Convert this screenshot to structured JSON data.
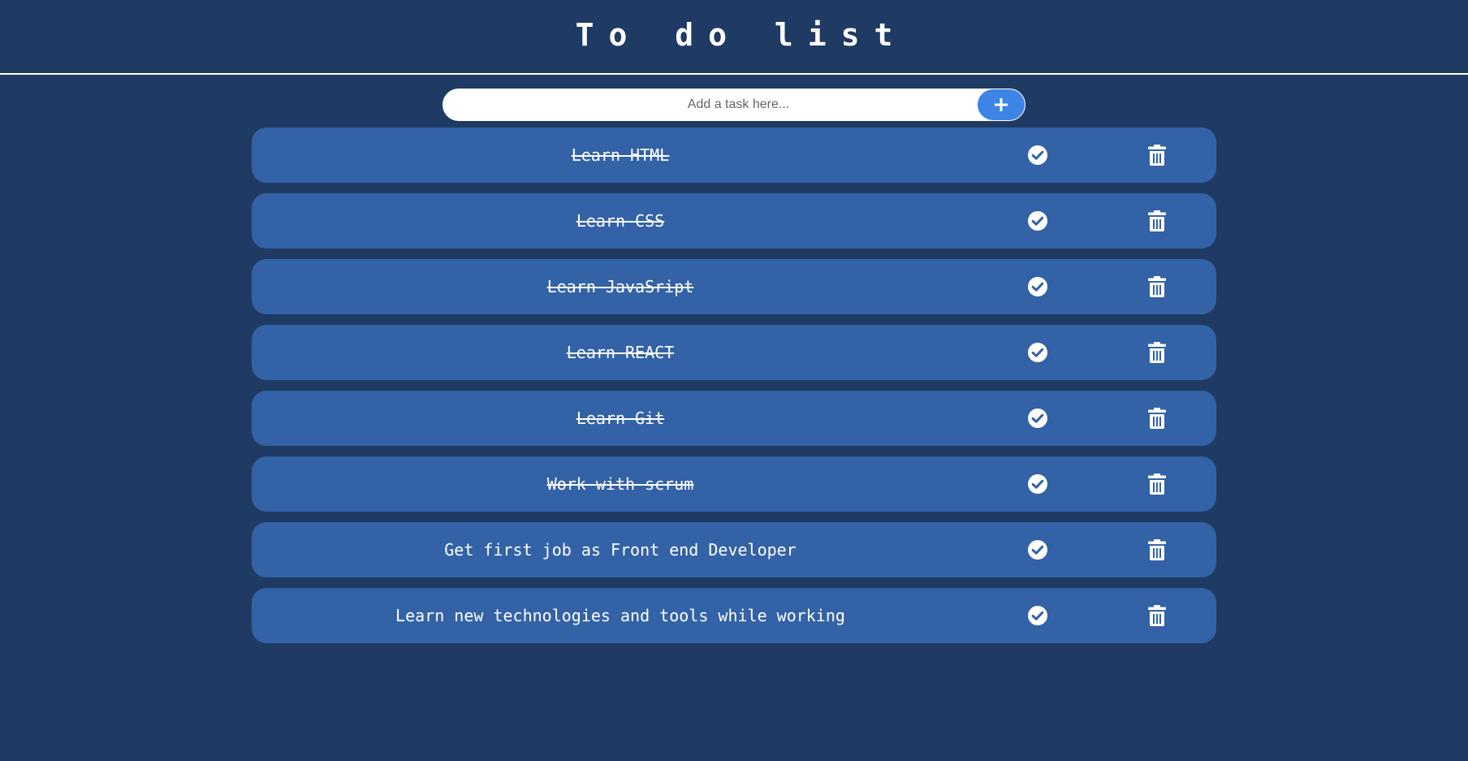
{
  "header": {
    "title": "To do list"
  },
  "add_task": {
    "placeholder": "Add a task here...",
    "button_icon": "plus-icon"
  },
  "todos": [
    {
      "text": "Learn HTML",
      "done": true
    },
    {
      "text": "Learn CSS",
      "done": true
    },
    {
      "text": "Learn JavaSript",
      "done": true
    },
    {
      "text": "Learn REACT",
      "done": true
    },
    {
      "text": "Learn Git",
      "done": true
    },
    {
      "text": "Work with scrum",
      "done": true
    },
    {
      "text": "Get first job as Front end Developer",
      "done": false
    },
    {
      "text": "Learn new technologies and tools while working",
      "done": false
    }
  ],
  "colors": {
    "background": "#1f3b63",
    "item_background": "#3362a6",
    "accent": "#3d84e6",
    "text": "#ffffff"
  }
}
